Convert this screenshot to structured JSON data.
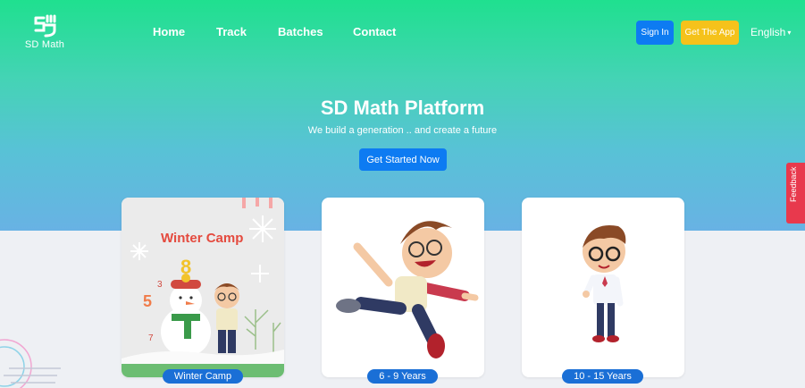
{
  "brand": {
    "name": "SD Math"
  },
  "nav": {
    "items": [
      "Home",
      "Track",
      "Batches",
      "Contact"
    ]
  },
  "header": {
    "signin_label": "Sign In",
    "app_label": "Get The App",
    "language": "English"
  },
  "hero": {
    "title": "SD Math Platform",
    "subtitle": "We build a generation .. and create a future",
    "cta_label": "Get Started Now"
  },
  "cards": [
    {
      "label": "Winter Camp",
      "art_title": "Winter Camp"
    },
    {
      "label": "6 - 9 Years"
    },
    {
      "label": "10 - 15 Years"
    }
  ],
  "feedback": {
    "label": "Feedback"
  },
  "colors": {
    "primary": "#0d7bf2",
    "accent": "#f5c21b",
    "hero_top": "#1fe08f",
    "hero_bottom": "#68b2e4",
    "feedback": "#e8394d"
  }
}
